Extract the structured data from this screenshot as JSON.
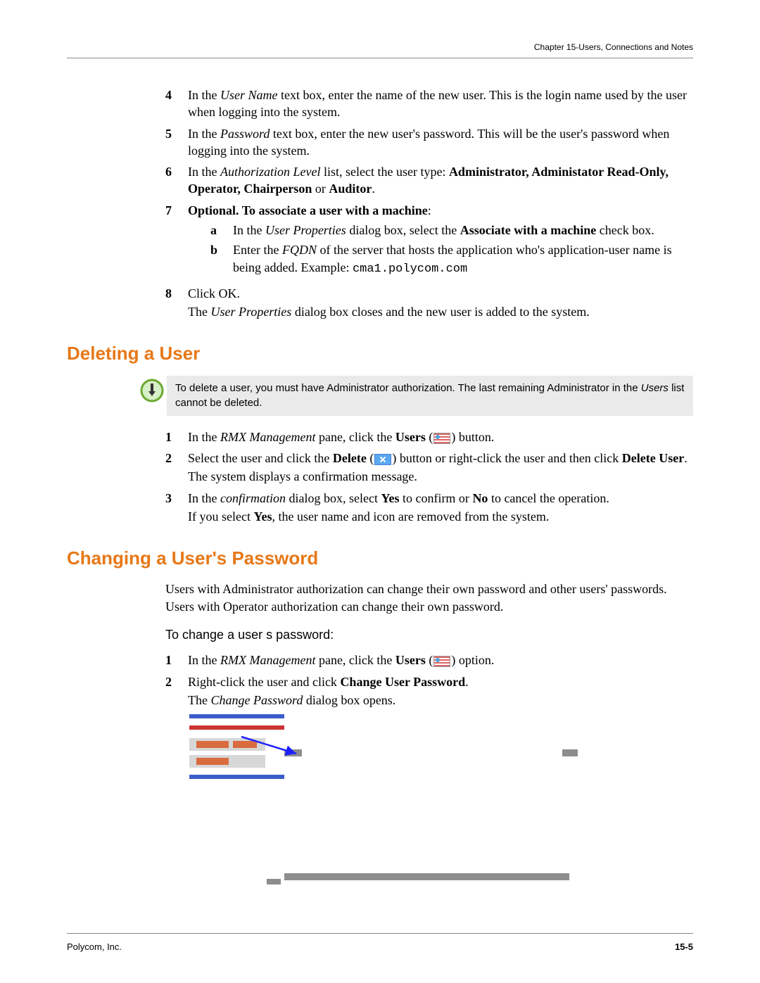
{
  "header": {
    "chapter": "Chapter 15-Users, Connections and Notes"
  },
  "steps_top": {
    "s4": {
      "num": "4",
      "pre": "In the ",
      "ital": "User Name",
      "post": " text box, enter the name of the new user. This is the login name used by the user when logging into the system."
    },
    "s5": {
      "num": "5",
      "pre": "In the ",
      "ital": "Password",
      "post": " text box, enter the new user's password. This will be the user's password when logging into the system."
    },
    "s6": {
      "num": "6",
      "pre": "In the ",
      "ital": "Authorization Level",
      "mid": " list, select the user type: ",
      "bold1": "Administrator, Administator Read-Only, Operator, Chairperson",
      "mid2": " or ",
      "bold2": "Auditor",
      "end": "."
    },
    "s7": {
      "num": "7",
      "bold": "Optional. To associate a user with a machine",
      "colon": ":",
      "a": {
        "sub": "a",
        "pre": "In the ",
        "ital": "User Properties",
        "mid": " dialog box, select the ",
        "bold": "Associate with a machine",
        "end": " check box."
      },
      "b": {
        "sub": "b",
        "pre": "Enter the ",
        "ital": "FQDN",
        "mid": " of the server that hosts the application who's application-user name is being added. Example: ",
        "code": "cma1.polycom.com"
      }
    },
    "s8": {
      "num": "8",
      "line1": "Click OK.",
      "line2a": "The ",
      "line2i": "User Properties",
      "line2b": " dialog box closes and the new user is added to the system."
    }
  },
  "section_delete": {
    "title": "Deleting a User",
    "note_a": "To delete a user, you must have Administrator authorization. The last remaining Administrator in the ",
    "note_i": "Users",
    "note_b": " list cannot be deleted.",
    "s1": {
      "num": "1",
      "pre": "In the ",
      "ital": "RMX Management",
      "mid": " pane, click the ",
      "bold": "Users",
      "btn_open": " (",
      "btn_close": ") button."
    },
    "s2": {
      "num": "2",
      "pre": "Select the user and click the ",
      "bold1": "Delete",
      "open": " (",
      "close": ") button or right-click the user and then click ",
      "bold2": "Delete User",
      "end": ".",
      "follow": "The system displays a confirmation message."
    },
    "s3": {
      "num": "3",
      "pre": "In the ",
      "ital": "confirmation",
      "mid": " dialog box, select ",
      "bold1": "Yes",
      "mid2": " to confirm or ",
      "bold2": "No",
      "end": " to cancel the operation.",
      "follow_a": "If you select ",
      "follow_bold": "Yes",
      "follow_b": ", the user name and icon are removed from the system."
    }
  },
  "section_change": {
    "title": "Changing a User's Password",
    "intro": "Users with Administrator authorization can change their own password and other users' passwords. Users with Operator authorization can change their own password.",
    "subhead": "To change a user s password:",
    "s1": {
      "num": "1",
      "pre": "In the ",
      "ital": "RMX Management",
      "mid": " pane, click the ",
      "bold": "Users",
      "open": " (",
      "close": ") option."
    },
    "s2": {
      "num": "2",
      "pre": "Right-click the user and click ",
      "bold": "Change User Password",
      "end": ".",
      "follow_a": "The ",
      "follow_i": "Change Password",
      "follow_b": " dialog box opens."
    }
  },
  "footer": {
    "left": "Polycom, Inc.",
    "right": "15-5"
  }
}
